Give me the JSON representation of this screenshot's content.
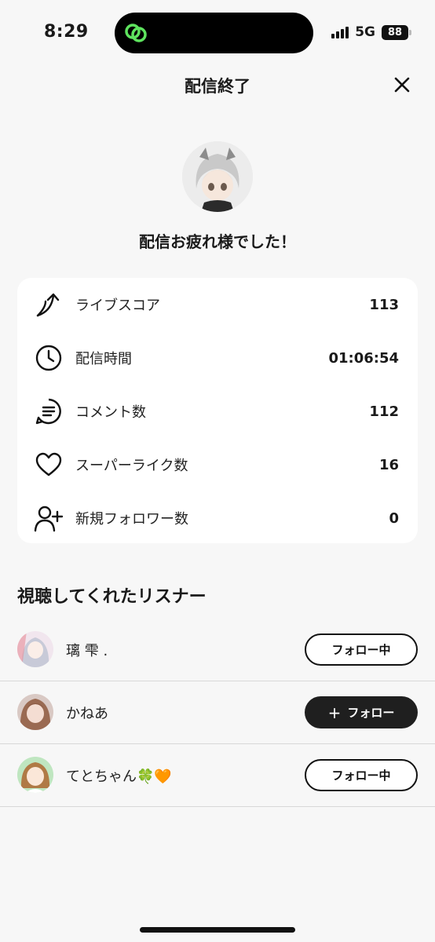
{
  "status_bar": {
    "time": "8:29",
    "network": "5G",
    "battery": "88"
  },
  "header": {
    "title": "配信終了"
  },
  "host": {
    "message": "配信お疲れ様でした！"
  },
  "stats": [
    {
      "icon": "arrow-up-icon",
      "label": "ライブスコア",
      "value": "113"
    },
    {
      "icon": "clock-icon",
      "label": "配信時間",
      "value": "01:06:54"
    },
    {
      "icon": "comment-icon",
      "label": "コメント数",
      "value": "112"
    },
    {
      "icon": "heart-icon",
      "label": "スーパーライク数",
      "value": "16"
    },
    {
      "icon": "add-user-icon",
      "label": "新規フォロワー数",
      "value": "0"
    }
  ],
  "listeners": {
    "title": "視聴してくれたリスナー",
    "items": [
      {
        "name": "璃 雫 .",
        "button": "フォロー中",
        "following": true
      },
      {
        "name": "かねあ",
        "button": "フォロー",
        "following": false
      },
      {
        "name": "てとちゃん🍀🧡",
        "button": "フォロー中",
        "following": true
      }
    ]
  },
  "colors": {
    "accent": "#5ee35e",
    "background": "#f7f7f7",
    "card": "#ffffff",
    "dark_button": "#1f1f1f"
  }
}
